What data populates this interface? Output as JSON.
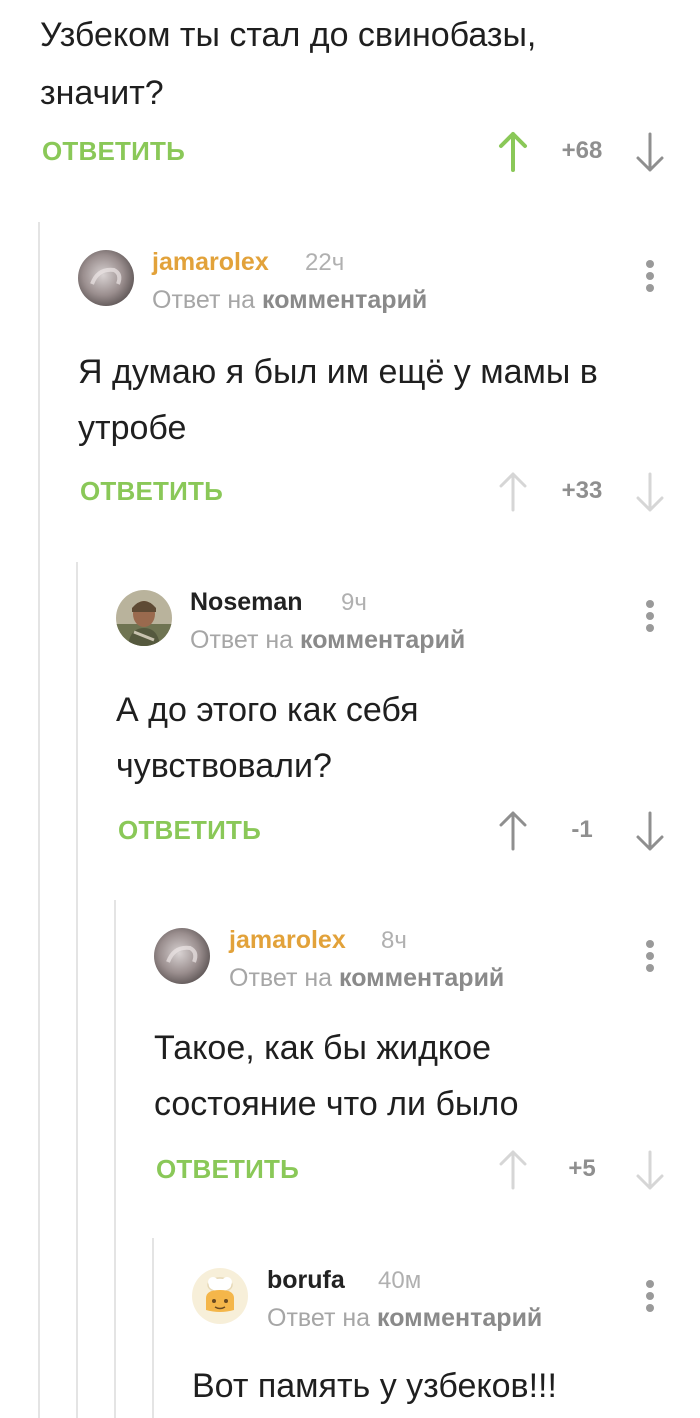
{
  "root_comment": {
    "text": "Узбеком ты стал до свинобазы, значит?",
    "reply_label": "ОТВЕТИТЬ",
    "score": "+68",
    "vote_state": "up"
  },
  "comments": [
    {
      "username": "jamarolex",
      "username_color": "#e2a23a",
      "time": "22ч",
      "reply_to_prefix": "Ответ на",
      "reply_to_target": "комментарий",
      "text": "Я думаю я был им ещё у мамы в утробе",
      "reply_label": "ОТВЕТИТЬ",
      "score": "+33",
      "avatar": "blurred-grey-avatar"
    },
    {
      "username": "Noseman",
      "username_color": "#222222",
      "time": "9ч",
      "reply_to_prefix": "Ответ на",
      "reply_to_target": "комментарий",
      "text": "А до этого как себя чувствовали?",
      "reply_label": "ОТВЕТИТЬ",
      "score": "-1",
      "avatar": "soldier-photo-avatar"
    },
    {
      "username": "jamarolex",
      "username_color": "#e2a23a",
      "time": "8ч",
      "reply_to_prefix": "Ответ на",
      "reply_to_target": "комментарий",
      "text": "Такое, как бы жидкое состояние что ли было",
      "reply_label": "ОТВЕТИТЬ",
      "score": "+5",
      "avatar": "blurred-grey-avatar"
    },
    {
      "username": "borufa",
      "username_color": "#222222",
      "time": "40м",
      "reply_to_prefix": "Ответ на",
      "reply_to_target": "комментарий",
      "text": "Вот память у узбеков!!!",
      "avatar": "chef-cartoon-avatar"
    }
  ],
  "colors": {
    "reply": "#8ac858",
    "vote_active": "#8ac858",
    "vote_inactive_light": "#d6d6d6",
    "vote_inactive_dark": "#8f8f8f"
  }
}
